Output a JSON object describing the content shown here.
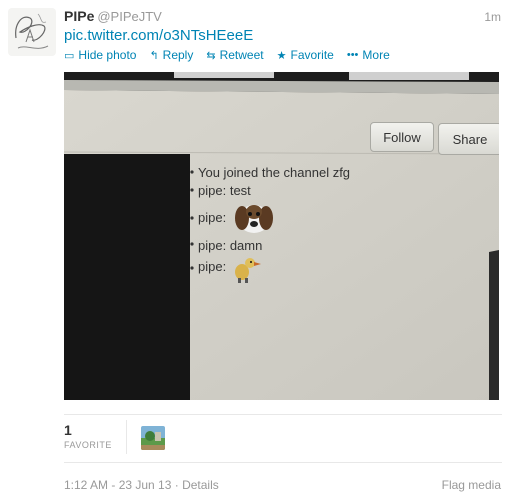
{
  "tweet": {
    "display_name": "PIPe",
    "handle": "@PIPeJTV",
    "time": "1m",
    "link": "pic.twitter.com/o3NTsHEeeE",
    "actions": {
      "hide_photo": "Hide photo",
      "reply": "Reply",
      "retweet": "Retweet",
      "favorite": "Favorite",
      "more": "More"
    }
  },
  "photo": {
    "follow": "Follow",
    "share": "Share",
    "chat": [
      {
        "name": "",
        "text": "You joined the channel zfg"
      },
      {
        "name": "pipe:",
        "text": "test"
      },
      {
        "name": "pipe:",
        "text": ""
      },
      {
        "name": "pipe:",
        "text": "damn"
      },
      {
        "name": "pipe:",
        "text": ""
      }
    ]
  },
  "stats": {
    "favorite_count": "1",
    "favorite_label": "FAVORITE"
  },
  "footer": {
    "timestamp": "1:12 AM - 23 Jun 13 · Details",
    "flag": "Flag media"
  },
  "colors": {
    "link": "#0084b4",
    "muted": "#999999"
  }
}
